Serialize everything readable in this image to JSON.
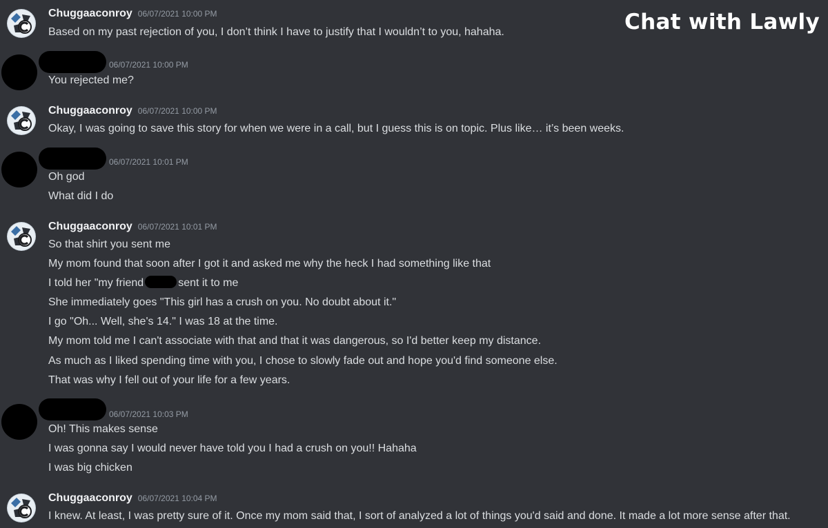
{
  "overlay": {
    "title": "Chat with Lawly"
  },
  "messages": [
    {
      "author": "Chuggaaconroy",
      "timestamp": "06/07/2021 10:00 PM",
      "lines": [
        "Based on my past rejection of you, I don’t think I have to justify that I wouldn’t to you, hahaha."
      ]
    },
    {
      "author": "",
      "author_redacted": true,
      "timestamp": "06/07/2021 10:00 PM",
      "lines": [
        "You rejected me?"
      ]
    },
    {
      "author": "Chuggaaconroy",
      "timestamp": "06/07/2021 10:00 PM",
      "lines": [
        "Okay, I was going to save this story for when we were in a call, but I guess this is on topic. Plus like… it’s been weeks."
      ]
    },
    {
      "author": "",
      "author_redacted": true,
      "timestamp": "06/07/2021 10:01 PM",
      "lines": [
        "Oh god",
        "What did I do"
      ]
    },
    {
      "author": "Chuggaaconroy",
      "timestamp": "06/07/2021 10:01 PM",
      "lines": [
        "So that shirt you sent me",
        "My mom found that soon after I got it and asked me why the heck I had something like that",
        "",
        "She immediately goes \"This girl has a crush on you. No doubt about it.\"",
        "I go \"Oh... Well, she's 14.\" I was 18 at the time.",
        "My mom told me I can't associate with that and that it was dangerous, so I'd better keep my distance.",
        "As much as I liked spending time with you, I chose to slowly fade out and hope you'd find someone else.",
        "That was why I fell out of your life for a few years."
      ],
      "redacted_line": {
        "before": "I told her \"my friend",
        "after": "sent it to me"
      }
    },
    {
      "author": "",
      "author_redacted": true,
      "timestamp": "06/07/2021 10:03 PM",
      "lines": [
        "Oh! This makes sense",
        "I was gonna say I would never have told you I had a crush on you!! Hahaha",
        "I was big chicken"
      ]
    },
    {
      "author": "Chuggaaconroy",
      "timestamp": "06/07/2021 10:04 PM",
      "lines": [
        "I knew. At least, I was pretty sure of it. Once my mom said that, I sort of analyzed a lot of things you'd said and done. It made a lot more sense after that."
      ]
    }
  ],
  "icons": {
    "avatar": "chuggaaconroy-avatar-icon",
    "redacted_avatar": "redacted-avatar"
  },
  "colors": {
    "background": "#313338",
    "text": "#dbdee1",
    "username": "#f2f3f5",
    "timestamp": "#949ba4"
  }
}
